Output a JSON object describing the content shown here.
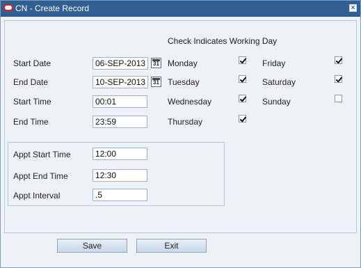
{
  "window": {
    "title": "CN - Create Record"
  },
  "form": {
    "start_date": {
      "label": "Start Date",
      "value": "06-SEP-2013"
    },
    "end_date": {
      "label": "End Date",
      "value": "10-SEP-2013"
    },
    "start_time": {
      "label": "Start Time",
      "value": "00:01"
    },
    "end_time": {
      "label": "End Time",
      "value": "23:59"
    },
    "calendar_icon_text": "31"
  },
  "working_days": {
    "heading": "Check Indicates Working Day",
    "days": [
      {
        "label": "Monday",
        "checked": true
      },
      {
        "label": "Tuesday",
        "checked": true
      },
      {
        "label": "Wednesday",
        "checked": true
      },
      {
        "label": "Thursday",
        "checked": true
      },
      {
        "label": "Friday",
        "checked": true
      },
      {
        "label": "Saturday",
        "checked": true
      },
      {
        "label": "Sunday",
        "checked": false
      }
    ]
  },
  "appointment": {
    "start_time": {
      "label": "Appt Start Time",
      "value": "12:00"
    },
    "end_time": {
      "label": "Appt End Time",
      "value": "12:30"
    },
    "interval": {
      "label": "Appt Interval",
      "value": ".5"
    }
  },
  "buttons": {
    "save": "Save",
    "exit": "Exit"
  }
}
